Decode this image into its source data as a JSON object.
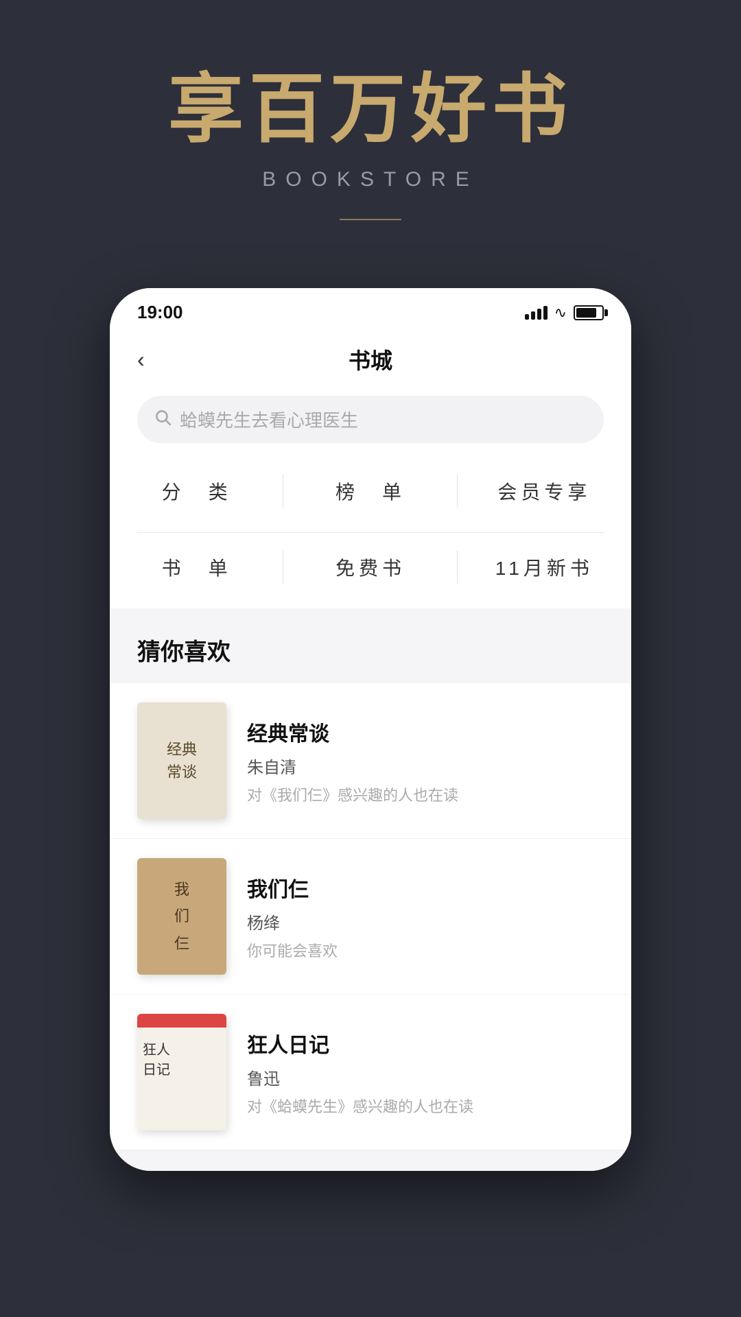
{
  "hero": {
    "title": "享百万好书",
    "subtitle": "BOOKSTORE",
    "divider": true
  },
  "status_bar": {
    "time": "19:00"
  },
  "nav": {
    "back_label": "‹",
    "title": "书城"
  },
  "search": {
    "placeholder": "蛤蟆先生去看心理医生"
  },
  "categories": {
    "items": [
      {
        "label": "分　类"
      },
      {
        "label": "榜　单"
      },
      {
        "label": "会员专享"
      },
      {
        "label": "书　单"
      },
      {
        "label": "免费书"
      },
      {
        "label": "11月新书"
      }
    ]
  },
  "recommend": {
    "section_title": "猜你喜欢",
    "books": [
      {
        "title": "经典常谈",
        "author": "朱自清",
        "desc": "对《我们仨》感兴趣的人也在读",
        "cover_text": "经典\n常谈"
      },
      {
        "title": "我们仨",
        "author": "杨绛",
        "desc": "你可能会喜欢",
        "cover_text": "我们仨"
      },
      {
        "title": "狂人日记",
        "author": "鲁迅",
        "desc": "对《蛤蟆先生》感兴趣的人也在读",
        "cover_text": "狂人\n日记"
      }
    ]
  }
}
